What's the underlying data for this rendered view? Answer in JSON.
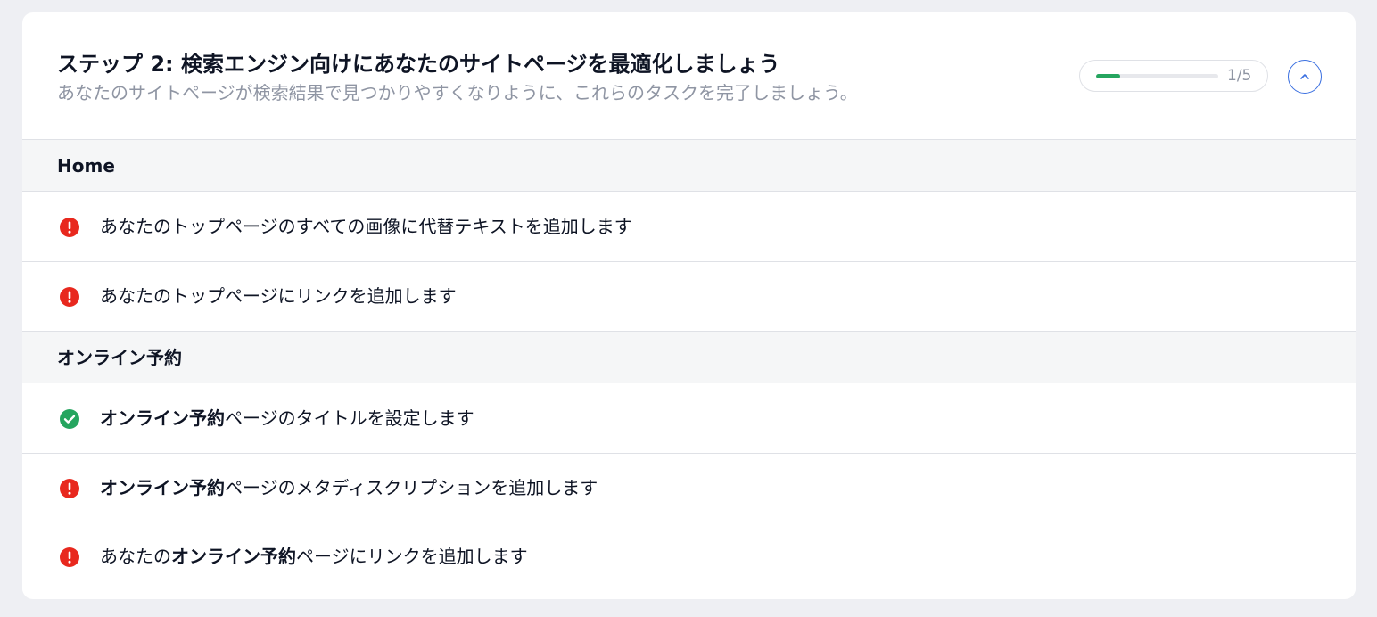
{
  "header": {
    "title": "ステップ 2: 検索エンジン向けにあなたのサイトページを最適化しましょう",
    "subtitle": "あなたのサイトページが検索結果で見つかりやすくなりように、これらのタスクを完了しましょう。",
    "progress_text": "1/5",
    "progress_fraction": 0.2
  },
  "sections": [
    {
      "title": "Home",
      "tasks": [
        {
          "status": "error",
          "parts": [
            "あなたのトップページのすべての画像に代替テキストを追加します"
          ]
        },
        {
          "status": "error",
          "parts": [
            "あなたのトップページにリンクを追加します"
          ]
        }
      ]
    },
    {
      "title": "オンライン予約",
      "tasks": [
        {
          "status": "done",
          "parts": [
            "オンライン予約",
            "ページのタイトルを設定します"
          ]
        },
        {
          "status": "error",
          "parts": [
            "オンライン予約",
            "ページのメタディスクリプションを追加します"
          ]
        },
        {
          "status": "error",
          "parts": [
            "あなたの",
            "オンライン予約",
            "ページにリンクを追加します"
          ]
        }
      ]
    }
  ],
  "colors": {
    "error": "#e8281e",
    "done": "#25a55f",
    "accent": "#3a6fe0"
  }
}
